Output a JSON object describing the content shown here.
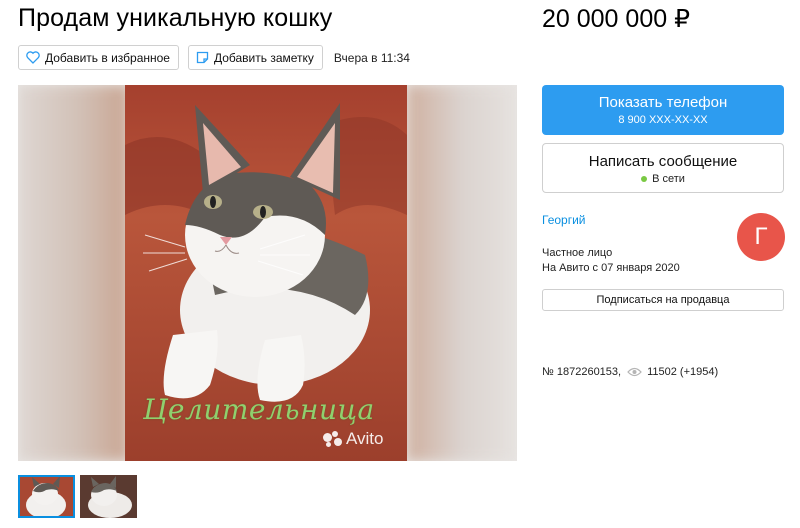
{
  "listing": {
    "title": "Продам уникальную кошку",
    "price": "20 000 000 ₽",
    "date": "Вчера в 11:34",
    "id_text": "№ 1872260153,",
    "views": "11502 (+1954)"
  },
  "actions": {
    "favorite_label": "Добавить в избранное",
    "note_label": "Добавить заметку"
  },
  "gallery": {
    "caption": "Целительница",
    "watermark": "Avito",
    "thumbnail_count": 2,
    "active_thumbnail": 1
  },
  "contact": {
    "phone_label": "Показать телефон",
    "phone_number": "8 900 XXX-XX-XX",
    "message_label": "Написать сообщение",
    "online_status": "В сети"
  },
  "seller": {
    "name": "Георгий",
    "avatar_letter": "Г",
    "avatar_color": "#e8554a",
    "type": "Частное лицо",
    "since": "На Авито с 07 января 2020",
    "subscribe_label": "Подписаться на продавца"
  },
  "colors": {
    "accent": "#2d9cf0",
    "link": "#0a8fe0",
    "online": "#7ac943"
  }
}
